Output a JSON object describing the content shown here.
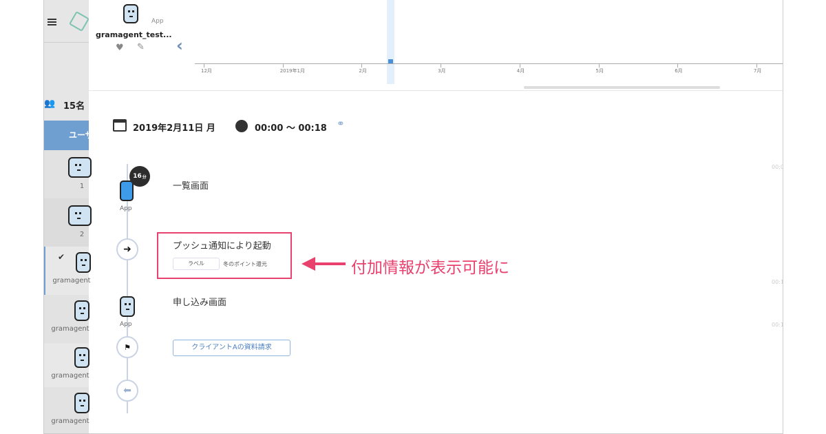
{
  "header": {
    "app_name": "gramagent_test...",
    "app_type": "App"
  },
  "timeline": {
    "months": [
      "12月",
      "2019年1月",
      "2月",
      "3月",
      "4月",
      "5月",
      "6月",
      "7月"
    ]
  },
  "sidebar": {
    "user_count": "15名",
    "active_tab": "ユーザ",
    "items": [
      {
        "label": "1"
      },
      {
        "label": "2"
      },
      {
        "label": "gramagent",
        "checked": true
      },
      {
        "label": "gramagent"
      },
      {
        "label": "gramagent"
      },
      {
        "label": "gramagent"
      }
    ]
  },
  "session": {
    "date": "2019年2月11日 月",
    "time": "00:00 〜 00:18"
  },
  "steps": [
    {
      "type": "screen",
      "source": "App",
      "duration": "16",
      "duration_unit": "分",
      "label": "一覧画面"
    },
    {
      "type": "event",
      "title": "プッシュ通知により起動",
      "tag": "ラベル",
      "tag_value": "冬のポイント還元"
    },
    {
      "type": "screen",
      "source": "App",
      "label": "申し込み画面"
    },
    {
      "type": "goal",
      "label": "クライアントAの資料請求"
    }
  ],
  "right_times": [
    "00:0",
    "00:1",
    "00:1"
  ],
  "annotation": {
    "text": "付加情報が表示可能に",
    "color": "#e8416e"
  }
}
